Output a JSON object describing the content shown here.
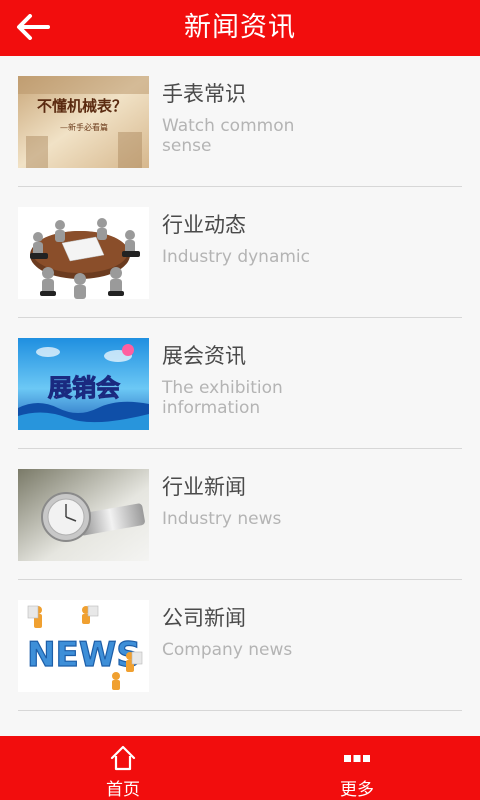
{
  "header": {
    "title": "新闻资讯",
    "back_icon": "arrow-left-icon"
  },
  "items": [
    {
      "title": "手表常识",
      "subtitle": "Watch common sense",
      "thumb_text": "不懂机械表？",
      "thumb_caption": "—新手必看篇"
    },
    {
      "title": "行业动态",
      "subtitle": "Industry dynamic"
    },
    {
      "title": "展会资讯",
      "subtitle": "The exhibition information",
      "thumb_text": "展销会"
    },
    {
      "title": "行业新闻",
      "subtitle": "Industry news"
    },
    {
      "title": "公司新闻",
      "subtitle": "Company news",
      "thumb_text": "NEWS"
    }
  ],
  "footer": {
    "tabs": [
      {
        "label": "首页",
        "icon": "home-icon"
      },
      {
        "label": "更多",
        "icon": "more-icon"
      }
    ]
  },
  "colors": {
    "brand": "#f20d0d"
  }
}
